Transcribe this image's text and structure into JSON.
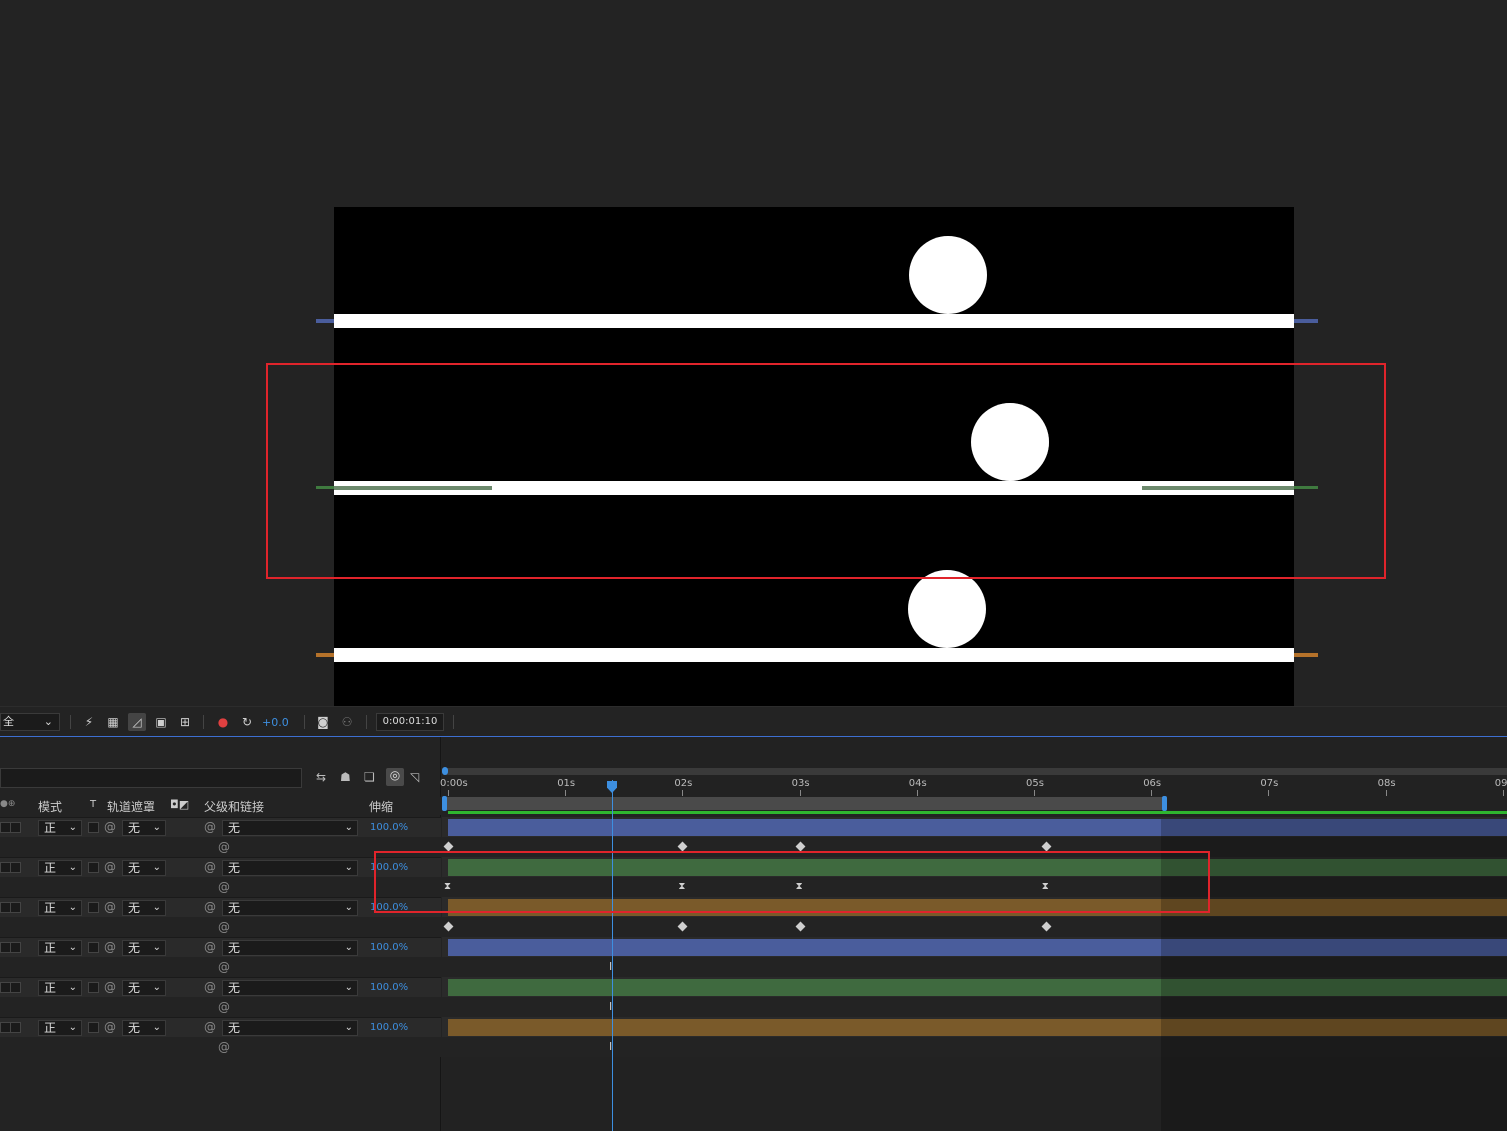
{
  "viewer": {
    "layers": [
      {
        "name": "layer-top",
        "color": "#4a5d9c"
      },
      {
        "name": "layer-middle",
        "color": "#3f7a3f"
      },
      {
        "name": "layer-bottom",
        "color": "#b5722a"
      }
    ]
  },
  "toolbar": {
    "dropdown_value": "全",
    "exposure_value": "+0.0",
    "timecode": "0:00:01:10",
    "icons": [
      "fast-preview-icon",
      "transparency-grid-icon",
      "mask-path-icon",
      "region-of-interest-icon",
      "guides-icon",
      "color-channel-icon",
      "reset-exposure-icon",
      "snapshot-icon",
      "show-snapshot-icon"
    ]
  },
  "timeline": {
    "columns": {
      "mode": "模式",
      "t": "T",
      "track_matte": "轨道遮罩",
      "parent_link": "父级和链接",
      "stretch": "伸缩"
    },
    "ruler": [
      "0:00s",
      "01s",
      "02s",
      "03s",
      "04s",
      "05s",
      "06s",
      "07s",
      "08s",
      "09"
    ],
    "layers": [
      {
        "mode": "正",
        "matte": "无",
        "parent": "无",
        "stretch": "100.0%",
        "color": "#4a5d9c",
        "key_type": "diamond"
      },
      {
        "mode": "正",
        "matte": "无",
        "parent": "无",
        "stretch": "100.0%",
        "color": "#3f6a3f",
        "key_type": "hold"
      },
      {
        "mode": "正",
        "matte": "无",
        "parent": "无",
        "stretch": "100.0%",
        "color": "#7a5a2a",
        "key_type": "diamond"
      },
      {
        "mode": "正",
        "matte": "无",
        "parent": "无",
        "stretch": "100.0%",
        "color": "#4a5d9c",
        "key_type": "cursor"
      },
      {
        "mode": "正",
        "matte": "无",
        "parent": "无",
        "stretch": "100.0%",
        "color": "#3f6a3f",
        "key_type": "cursor"
      },
      {
        "mode": "正",
        "matte": "无",
        "parent": "无",
        "stretch": "100.0%",
        "color": "#7a5a2a",
        "key_type": "cursor"
      }
    ],
    "current_time_s": 1.42,
    "work_area_end_s": 6.1
  }
}
